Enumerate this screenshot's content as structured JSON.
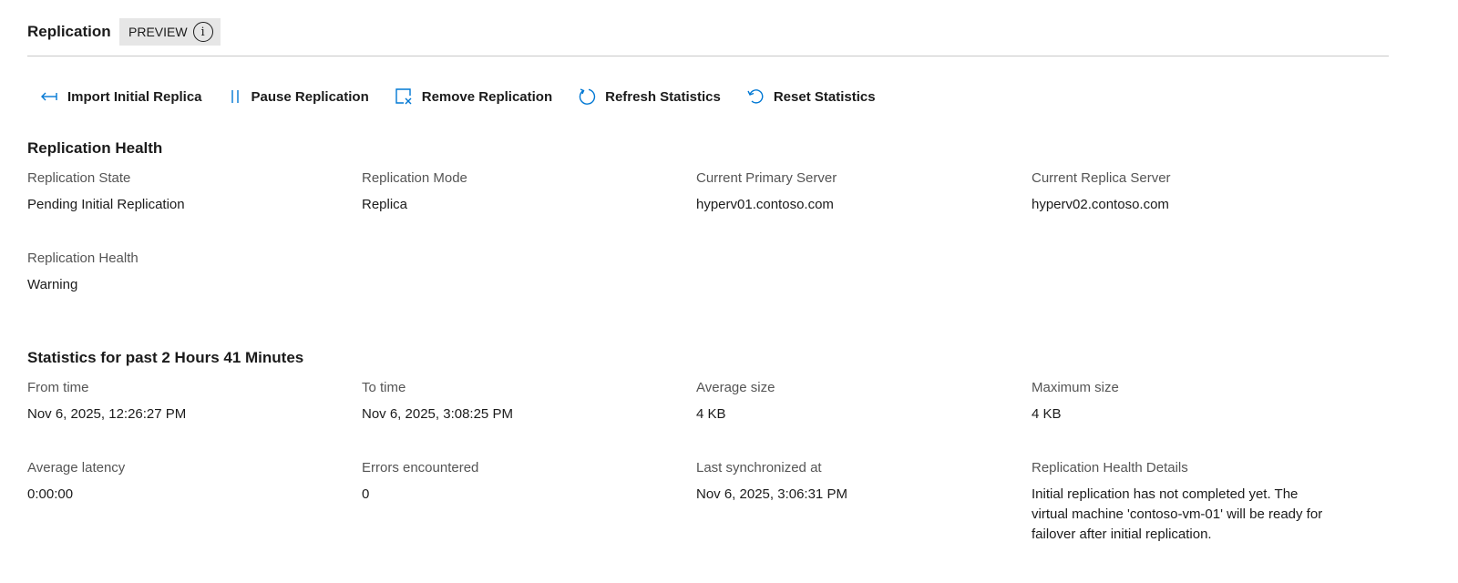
{
  "header": {
    "title": "Replication",
    "badge": "PREVIEW",
    "info_icon": "i"
  },
  "toolbar": [
    {
      "icon": "import-arrow-icon",
      "label": "Import Initial Replica"
    },
    {
      "icon": "pause-icon",
      "label": "Pause Replication"
    },
    {
      "icon": "remove-icon",
      "label": "Remove Replication"
    },
    {
      "icon": "refresh-icon",
      "label": "Refresh Statistics"
    },
    {
      "icon": "reset-icon",
      "label": "Reset Statistics"
    }
  ],
  "health": {
    "title": "Replication Health",
    "fields": [
      {
        "label": "Replication State",
        "value": "Pending Initial Replication"
      },
      {
        "label": "Replication Mode",
        "value": "Replica"
      },
      {
        "label": "Current Primary Server",
        "value": "hyperv01.contoso.com"
      },
      {
        "label": "Current Replica Server",
        "value": "hyperv02.contoso.com"
      },
      {
        "label": "Replication Health",
        "value": "Warning"
      }
    ]
  },
  "stats": {
    "title": "Statistics for past 2 Hours 41 Minutes",
    "fields": [
      {
        "label": "From time",
        "value": "Nov 6, 2025, 12:26:27 PM"
      },
      {
        "label": "To time",
        "value": "Nov 6, 2025, 3:08:25 PM"
      },
      {
        "label": "Average size",
        "value": "4 KB"
      },
      {
        "label": "Maximum size",
        "value": "4 KB"
      },
      {
        "label": "Average latency",
        "value": "0:00:00"
      },
      {
        "label": "Errors encountered",
        "value": "0"
      },
      {
        "label": "Last synchronized at",
        "value": "Nov 6, 2025, 3:06:31 PM"
      },
      {
        "label": "Replication Health Details",
        "value": "Initial replication has not completed yet. The virtual machine 'contoso-vm-01' will be ready for failover after initial replication."
      }
    ]
  },
  "colors": {
    "accent": "#0078d4",
    "text": "#1b1b1b",
    "label": "#555555",
    "badge_bg": "#e6e6e6"
  }
}
